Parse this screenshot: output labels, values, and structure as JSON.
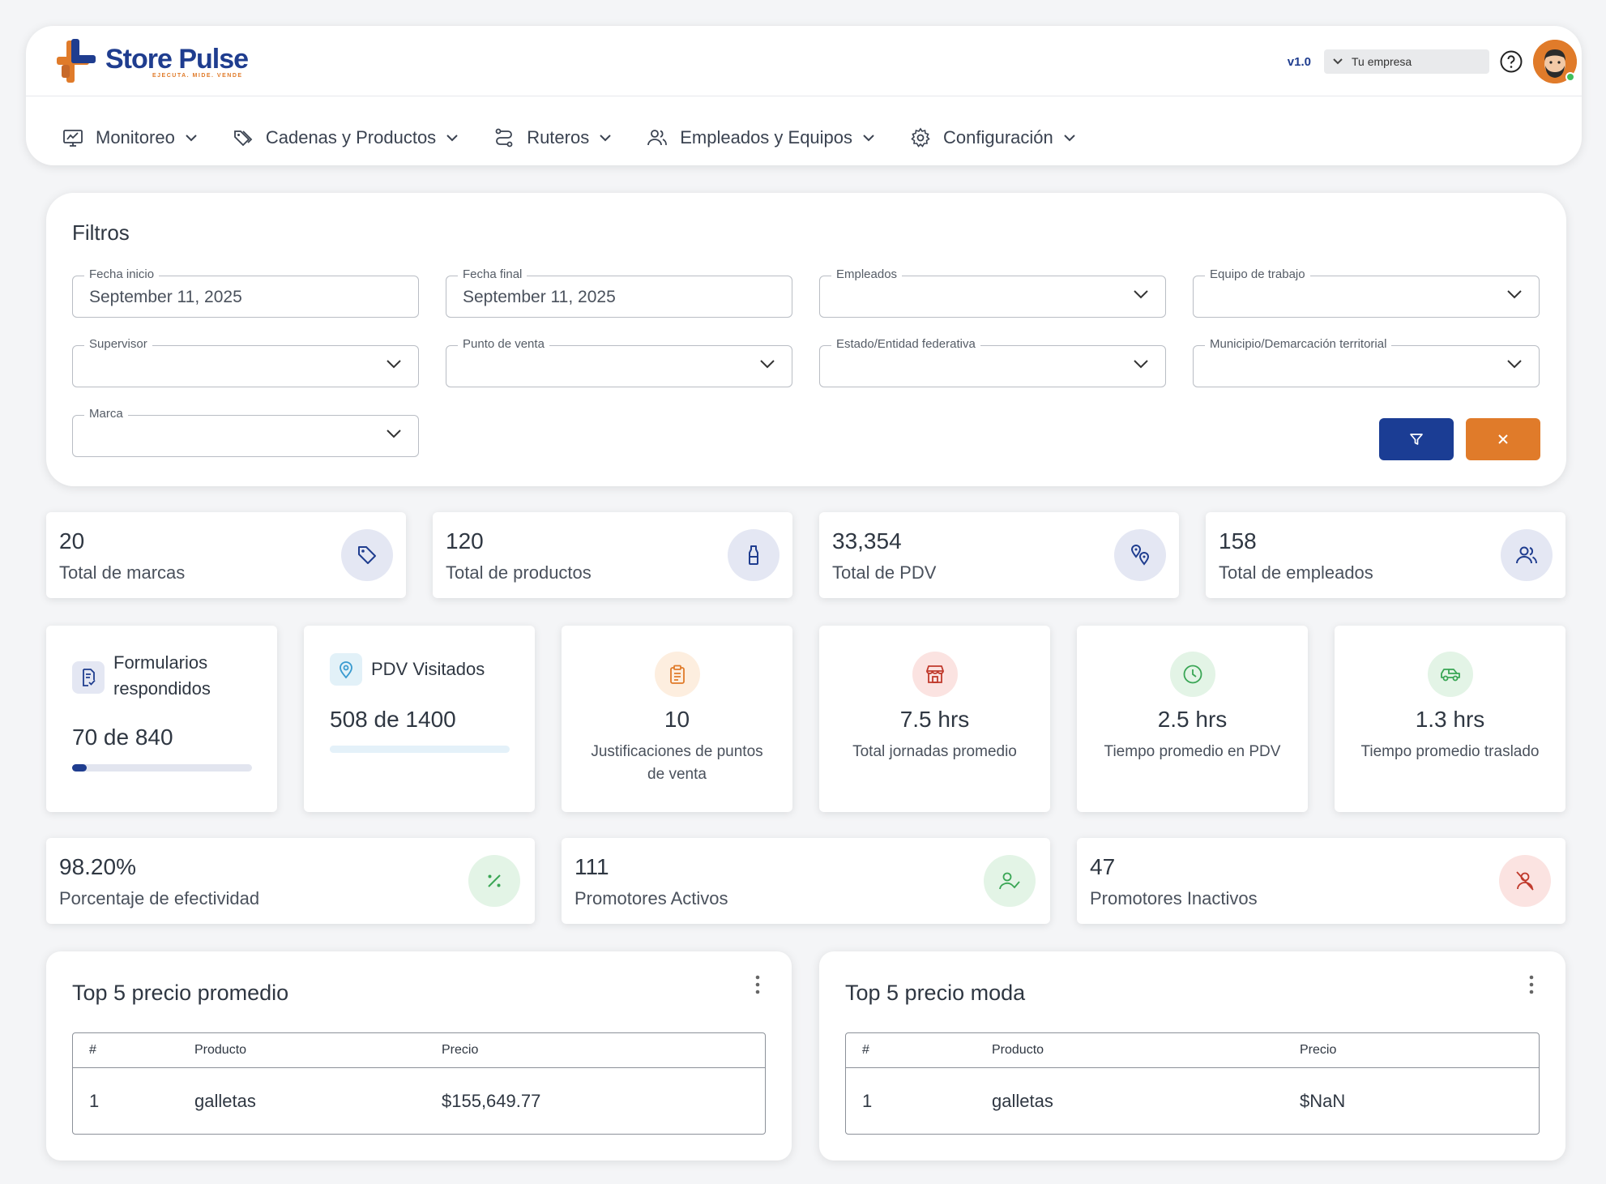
{
  "header": {
    "logo_name": "Store Pulse",
    "logo_tagline": "EJECUTA. MIDE. VENDE",
    "version": "v1.0",
    "company_placeholder": "Tu empresa"
  },
  "nav": [
    {
      "label": "Monitoreo",
      "icon": "monitor-chart-icon"
    },
    {
      "label": "Cadenas y Productos",
      "icon": "tags-icon"
    },
    {
      "label": "Ruteros",
      "icon": "route-icon"
    },
    {
      "label": "Empleados y Equipos",
      "icon": "users-icon"
    },
    {
      "label": "Configuración",
      "icon": "gear-icon"
    }
  ],
  "filters": {
    "title": "Filtros",
    "fields": [
      {
        "label": "Fecha inicio",
        "value": "September 11, 2025"
      },
      {
        "label": "Fecha final",
        "value": "September 11, 2025"
      },
      {
        "label": "Empleados",
        "value": ""
      },
      {
        "label": "Equipo de trabajo",
        "value": ""
      },
      {
        "label": "Supervisor",
        "value": ""
      },
      {
        "label": "Punto de venta",
        "value": ""
      },
      {
        "label": "Estado/Entidad federativa",
        "value": ""
      },
      {
        "label": "Municipio/Demarcación territorial",
        "value": ""
      },
      {
        "label": "Marca",
        "value": ""
      }
    ]
  },
  "totals": [
    {
      "value": "20",
      "label": "Total de marcas",
      "icon": "tag-icon"
    },
    {
      "value": "120",
      "label": "Total de productos",
      "icon": "bottle-icon"
    },
    {
      "value": "33,354",
      "label": "Total de PDV",
      "icon": "map-pins-icon"
    },
    {
      "value": "158",
      "label": "Total de empleados",
      "icon": "users-icon"
    }
  ],
  "forms": {
    "title": "Formularios respondidos",
    "value": "70 de 840",
    "progress": 0.083
  },
  "pdv_visited": {
    "title": "PDV Visitados",
    "value": "508 de 1400",
    "progress": 0.363
  },
  "metrics": [
    {
      "value": "10",
      "label": "Justificaciones de puntos de venta",
      "icon": "clipboard-icon",
      "color": "#e07b2a",
      "bg": "#fdeedf"
    },
    {
      "value": "7.5 hrs",
      "label": "Total jornadas promedio",
      "icon": "store-icon",
      "color": "#c0392b",
      "bg": "#fbe3e1"
    },
    {
      "value": "2.5 hrs",
      "label": "Tiempo promedio en PDV",
      "icon": "clock-icon",
      "color": "#3aa655",
      "bg": "#e3f4e6"
    },
    {
      "value": "1.3 hrs",
      "label": "Tiempo promedio traslado",
      "icon": "car-icon",
      "color": "#3aa655",
      "bg": "#e3f4e6"
    }
  ],
  "promoters": [
    {
      "value": "98.20%",
      "label": "Porcentaje de efectividad",
      "icon": "percent-icon"
    },
    {
      "value": "111",
      "label": "Promotores Activos",
      "icon": "user-check-icon"
    },
    {
      "value": "47",
      "label": "Promotores Inactivos",
      "icon": "user-off-icon"
    }
  ],
  "top_avg": {
    "title": "Top 5 precio promedio",
    "headers": [
      "#",
      "Producto",
      "Precio"
    ],
    "rows": [
      [
        "1",
        "galletas",
        "$155,649.77"
      ]
    ]
  },
  "top_mode": {
    "title": "Top 5 precio moda",
    "headers": [
      "#",
      "Producto",
      "Precio"
    ],
    "rows": [
      [
        "1",
        "galletas",
        "$NaN"
      ]
    ]
  }
}
